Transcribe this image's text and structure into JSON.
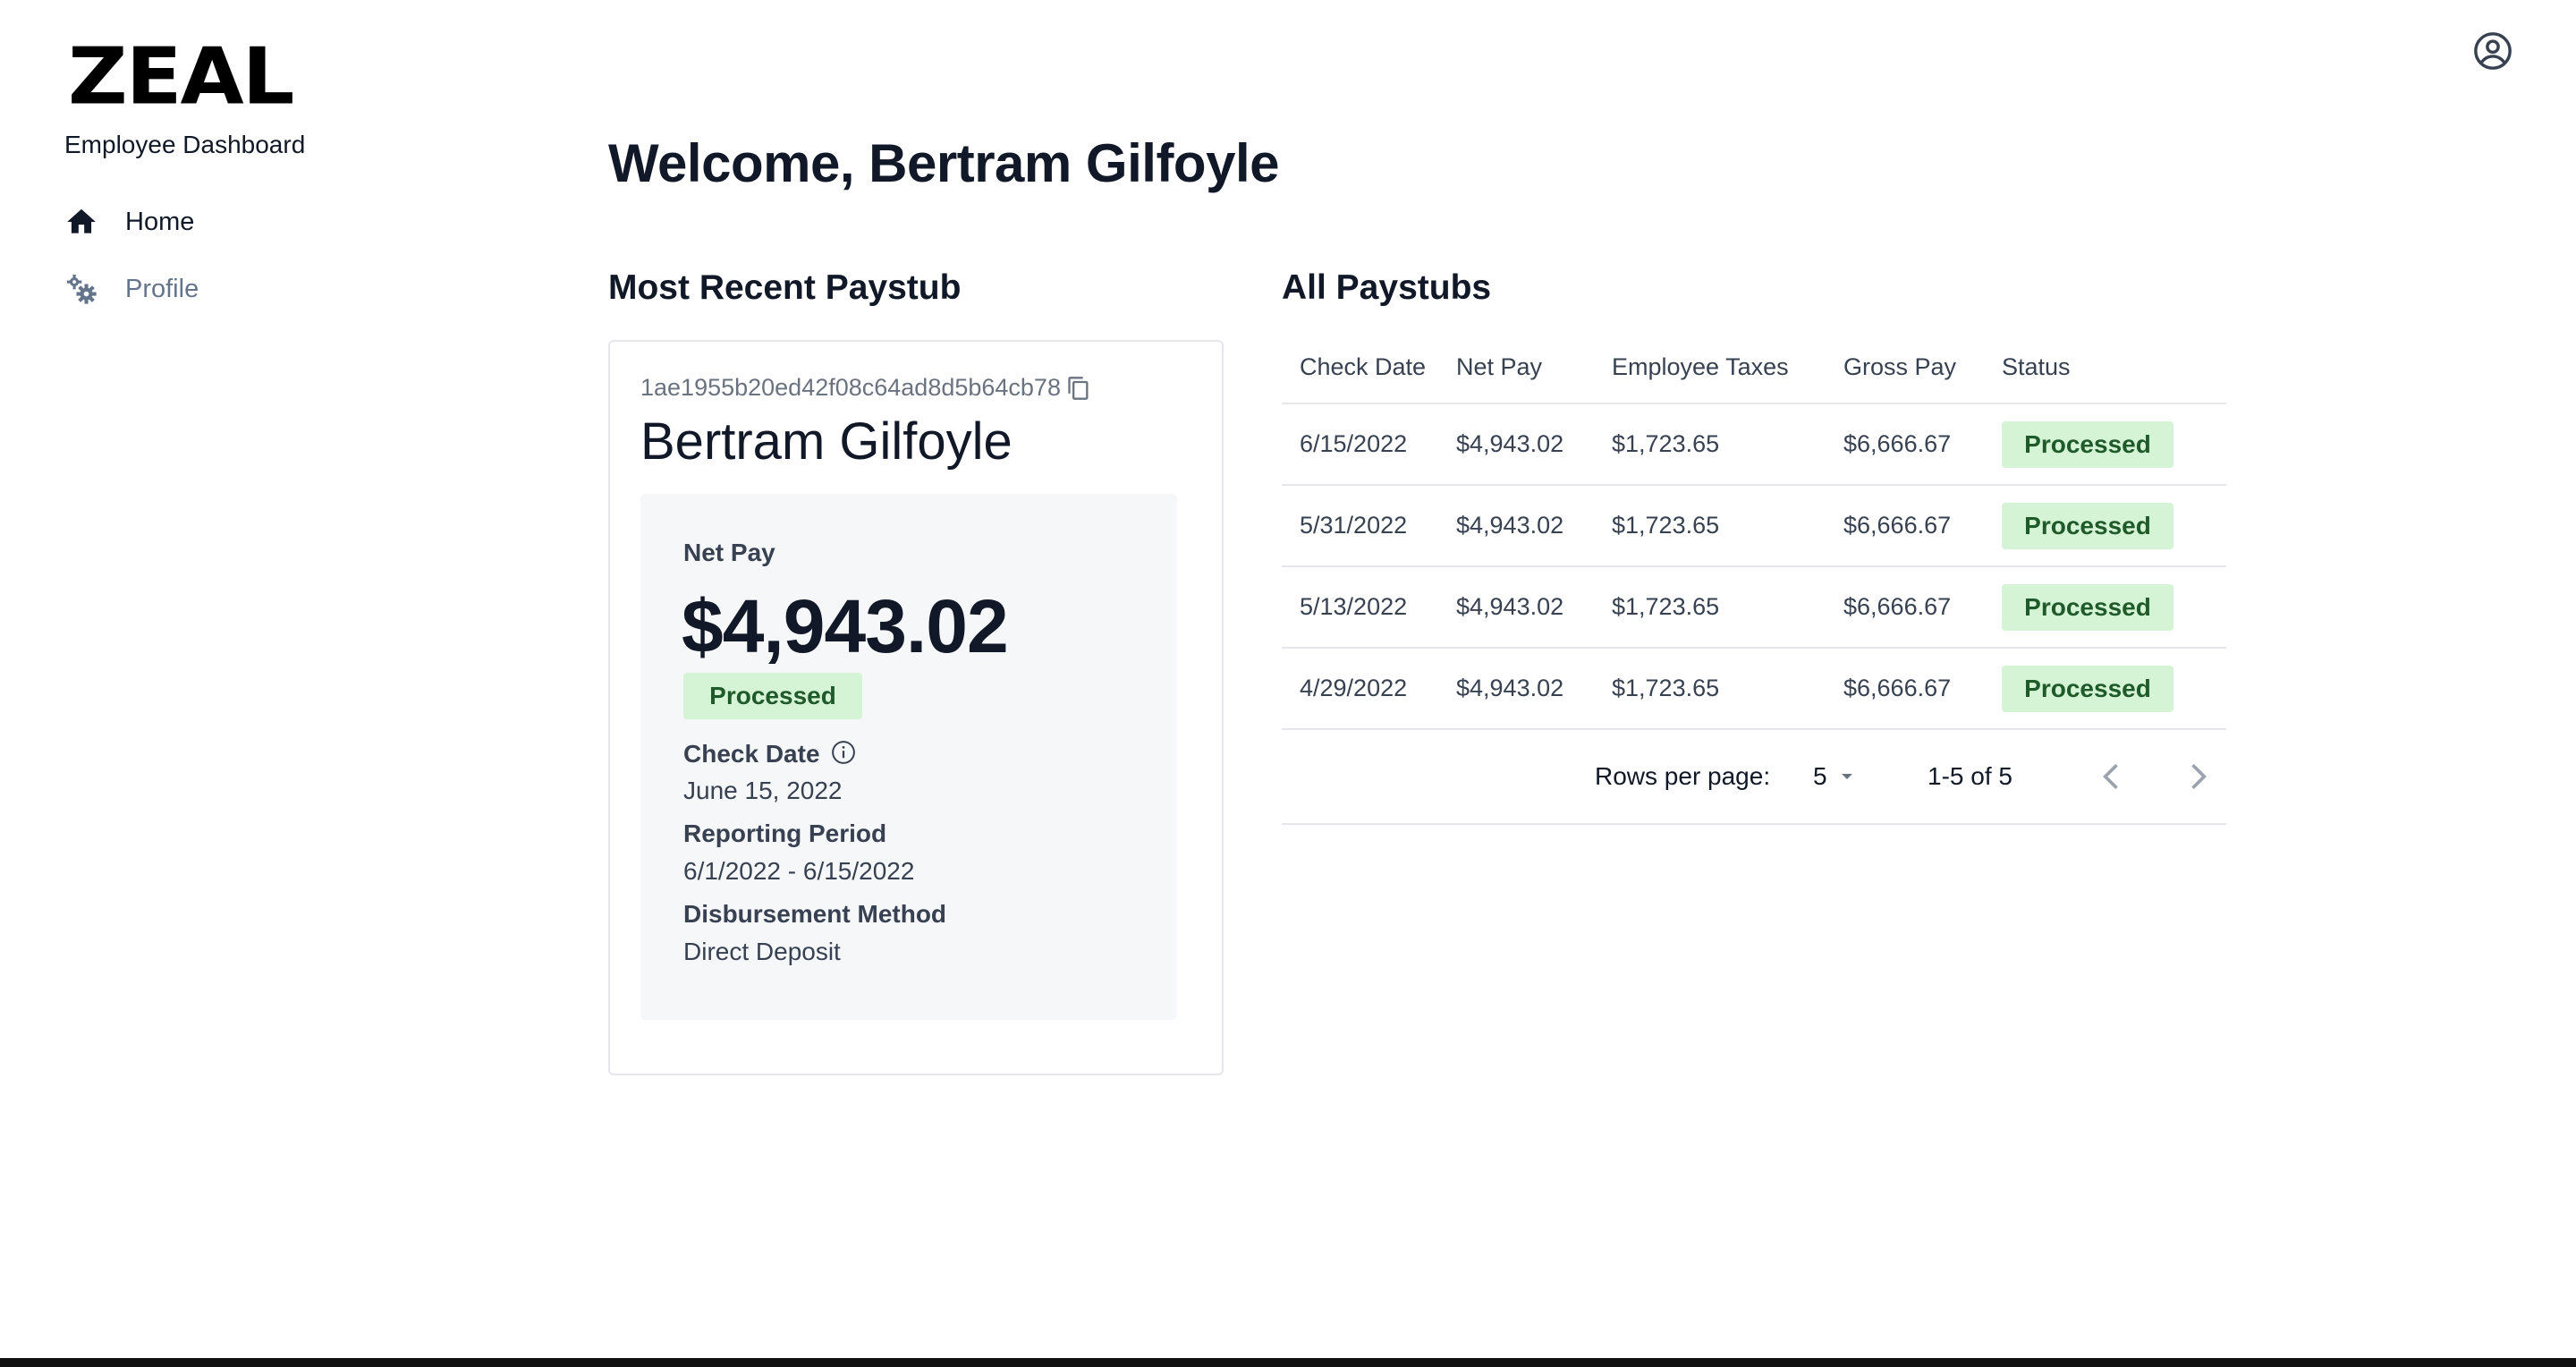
{
  "brand": {
    "logo_text": "ZEAL",
    "subtitle": "Employee Dashboard"
  },
  "sidebar": {
    "items": [
      {
        "label": "Home",
        "icon": "home-icon",
        "active": true
      },
      {
        "label": "Profile",
        "icon": "gears-icon",
        "active": false
      }
    ]
  },
  "header": {
    "welcome": "Welcome, Bertram Gilfoyle",
    "account_icon": "account-circle-icon"
  },
  "recent": {
    "section_title": "Most Recent Paystub",
    "paystub_id": "1ae1955b20ed42f08c64ad8d5b64cb78",
    "employee_name": "Bertram Gilfoyle",
    "net_pay_label": "Net Pay",
    "net_pay": "$4,943.02",
    "status": "Processed",
    "check_date_label": "Check Date",
    "check_date": "June 15, 2022",
    "period_label": "Reporting Period",
    "period": "6/1/2022 - 6/15/2022",
    "method_label": "Disbursement Method",
    "method": "Direct Deposit"
  },
  "all_paystubs": {
    "section_title": "All Paystubs",
    "columns": [
      "Check Date",
      "Net Pay",
      "Employee Taxes",
      "Gross Pay",
      "Status"
    ],
    "rows": [
      {
        "check_date": "6/15/2022",
        "net_pay": "$4,943.02",
        "taxes": "$1,723.65",
        "gross": "$6,666.67",
        "status": "Processed"
      },
      {
        "check_date": "5/31/2022",
        "net_pay": "$4,943.02",
        "taxes": "$1,723.65",
        "gross": "$6,666.67",
        "status": "Processed"
      },
      {
        "check_date": "5/13/2022",
        "net_pay": "$4,943.02",
        "taxes": "$1,723.65",
        "gross": "$6,666.67",
        "status": "Processed"
      },
      {
        "check_date": "4/29/2022",
        "net_pay": "$4,943.02",
        "taxes": "$1,723.65",
        "gross": "$6,666.67",
        "status": "Processed"
      }
    ],
    "pagination": {
      "rows_per_page_label": "Rows per page:",
      "rows_per_page": "5",
      "range": "1-5 of 5"
    }
  },
  "colors": {
    "badge_bg": "#d5f3d5",
    "badge_text": "#1f5a2a",
    "nav_inactive": "#64748b"
  }
}
